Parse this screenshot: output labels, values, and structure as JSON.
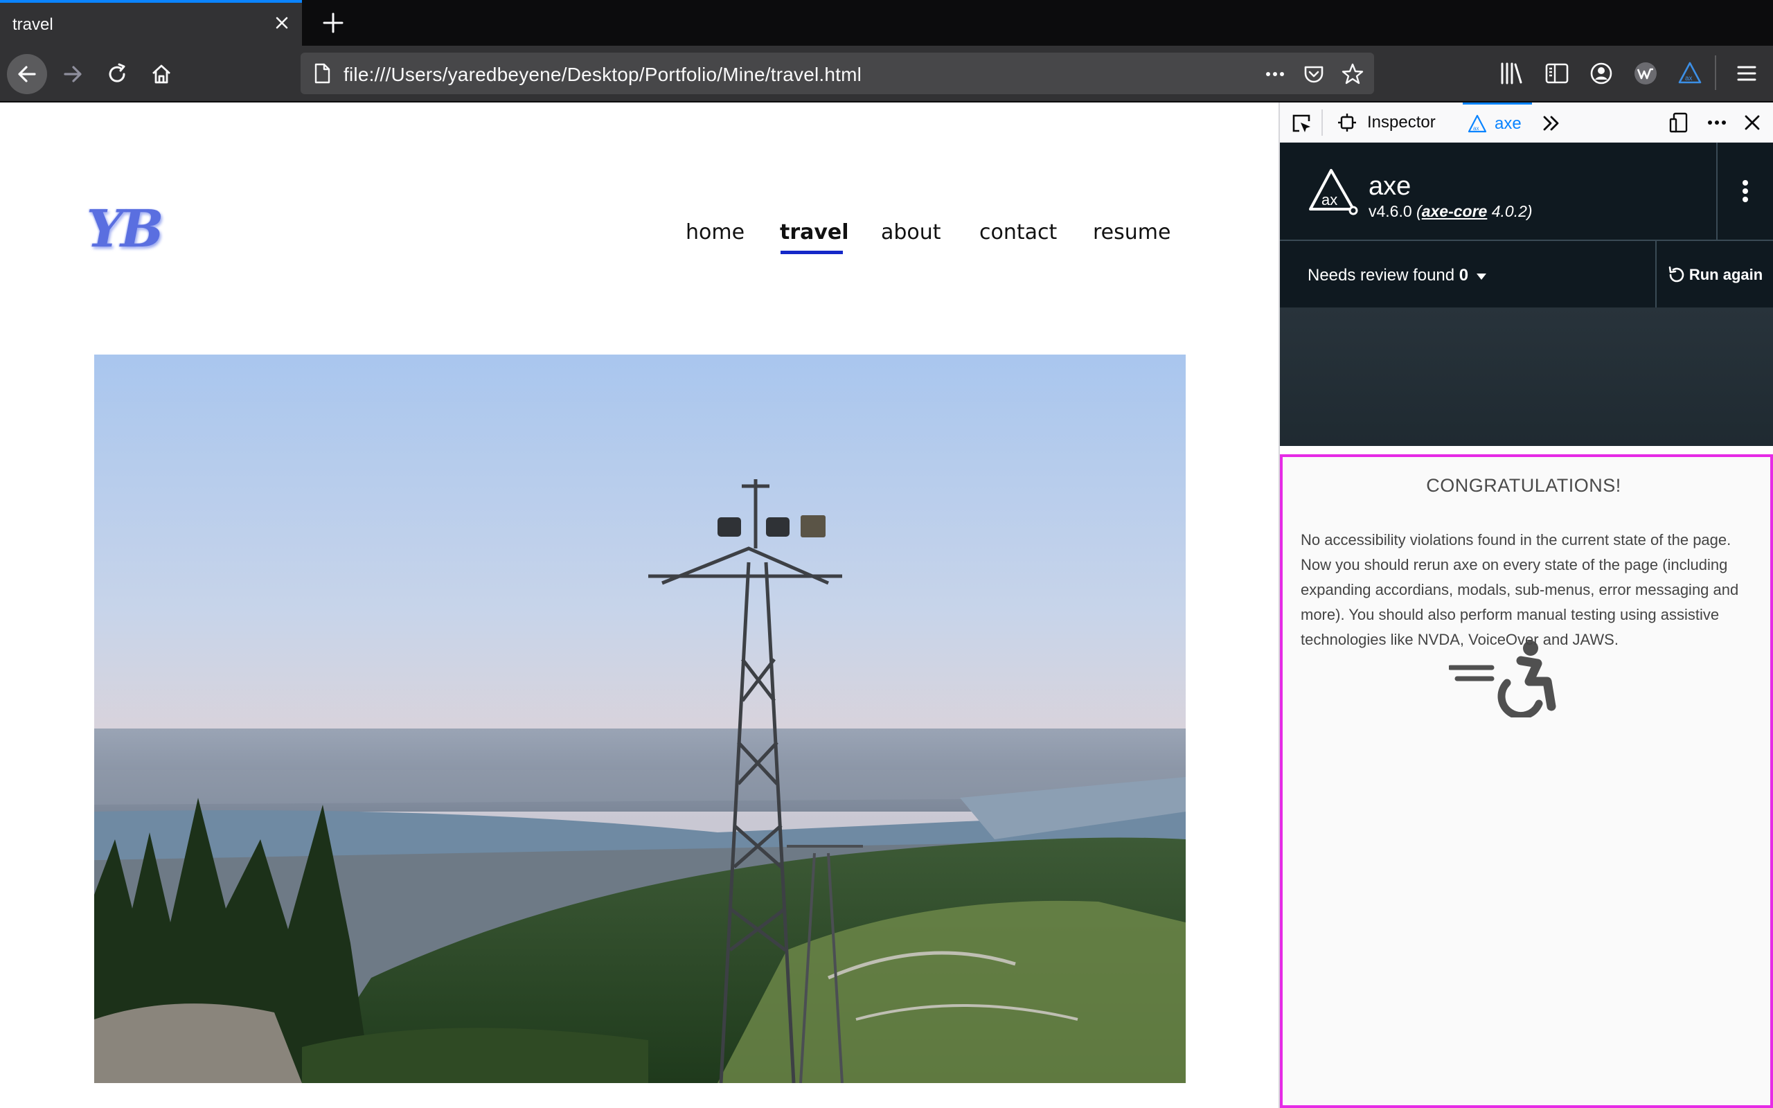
{
  "browser": {
    "tab_title": "travel",
    "url": "file:///Users/yaredbeyene/Desktop/Portfolio/Mine/travel.html"
  },
  "site": {
    "logo": "YB",
    "nav": [
      {
        "label": "home"
      },
      {
        "label": "travel",
        "active": true
      },
      {
        "label": "about"
      },
      {
        "label": "contact"
      },
      {
        "label": "resume"
      }
    ]
  },
  "devtools": {
    "tabs": {
      "inspector": "Inspector",
      "axe": "axe"
    },
    "axe": {
      "title": "axe",
      "version": "v4.6.0",
      "core_label": "axe-core",
      "core_version": "4.0.2",
      "needs_review_label": "Needs review found",
      "needs_review_count": "0",
      "run_again": "Run again",
      "congrats_title": "CONGRATULATIONS!",
      "congrats_body": "No accessibility violations found in the current state of the page. Now you should rerun axe on every state of the page (including expanding accordians, modals, sub-menus, error messaging and more). You should also perform manual testing using assistive technologies like NVDA, VoiceOver and JAWS."
    }
  },
  "colors": {
    "accent": "#0a84ff",
    "nav_underline": "#1528c8",
    "result_border": "#e62be6"
  }
}
